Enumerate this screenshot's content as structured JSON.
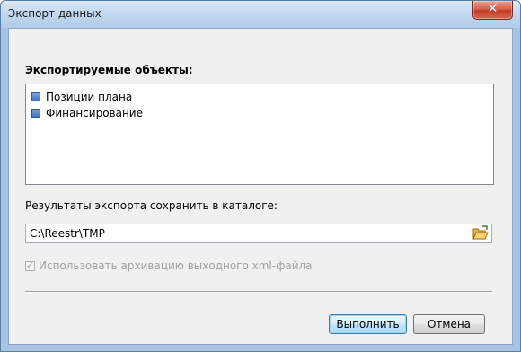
{
  "window": {
    "title": "Экспорт данных",
    "close_symbol": "✕"
  },
  "objects": {
    "label": "Экспортируемые объекты:",
    "items": [
      {
        "label": "Позиции плана",
        "icon": "blue-square-icon"
      },
      {
        "label": "Финансирование",
        "icon": "blue-square-icon"
      }
    ]
  },
  "folder": {
    "label": "Результаты экспорта сохранить в каталоге:",
    "value": "C:\\Reestr\\TMP",
    "browse_icon": "open-folder-icon"
  },
  "archive": {
    "label": "Использовать архивацию выходного xml-файла",
    "checked": true,
    "enabled": false
  },
  "buttons": {
    "ok": "Выполнить",
    "cancel": "Отмена"
  },
  "colors": {
    "title_bar": "#c3d8f0",
    "close_button": "#c23a22",
    "primary_button_border": "#3c7fb1",
    "disabled_text": "#a0a0a0"
  }
}
